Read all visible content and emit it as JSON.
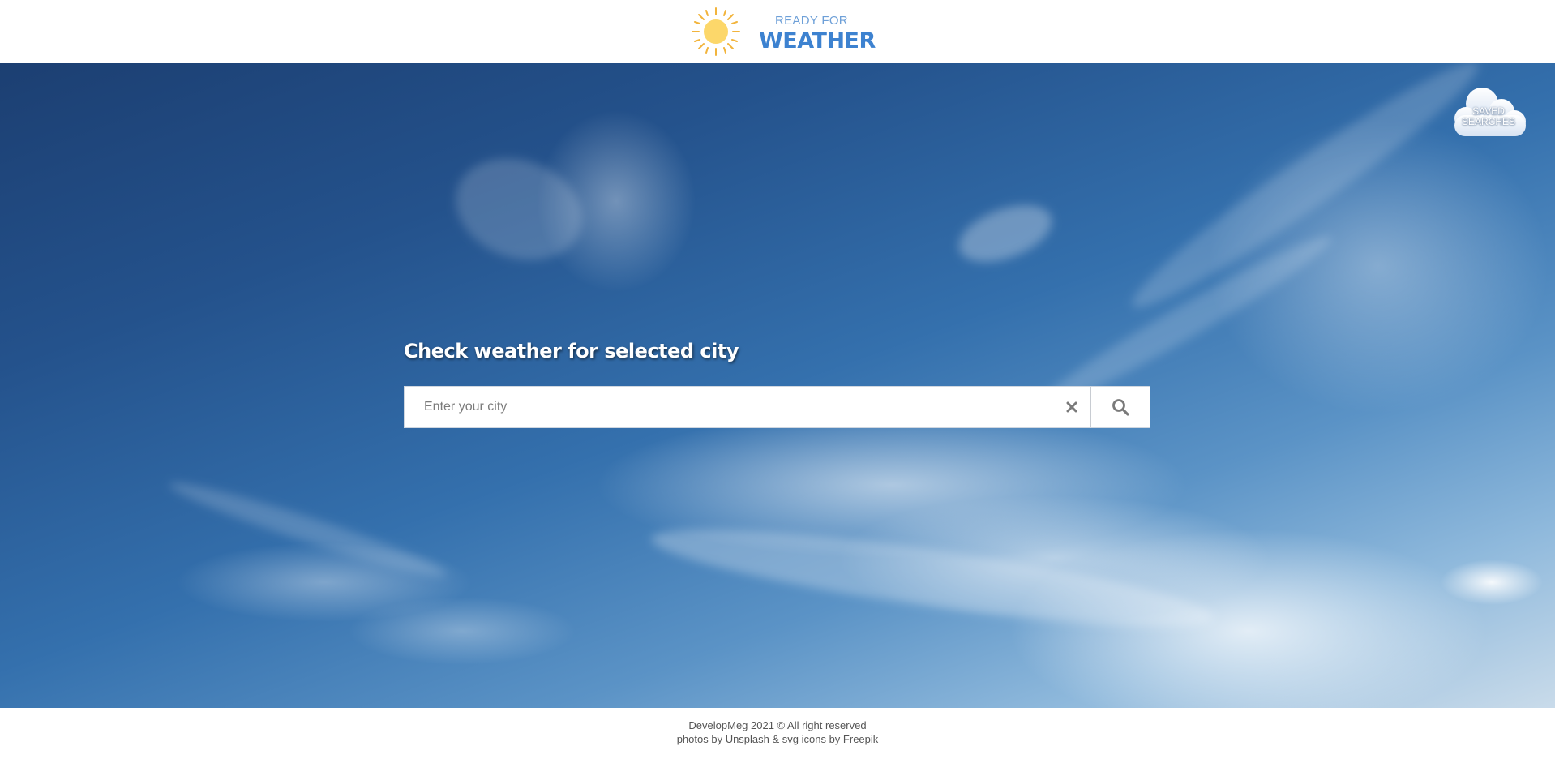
{
  "header": {
    "logo_small": "READY FOR",
    "logo_big": "WEATHER",
    "logo_icon": "sun-icon"
  },
  "saved": {
    "label_line1": "SAVED",
    "label_line2": "SEARCHES",
    "icon": "cloud-icon"
  },
  "search": {
    "title": "Check weather for selected city",
    "placeholder": "Enter your city",
    "value": "",
    "clear_icon": "close-icon",
    "search_icon": "search-icon"
  },
  "footer": {
    "line1": "DevelopMeg 2021 © All right reserved",
    "line2": "photos by Unsplash & svg icons by Freepik"
  },
  "colors": {
    "brand_blue": "#3d82d0",
    "brand_light_blue": "#6ea0d8",
    "sun_yellow": "#fcd76a",
    "sun_ray": "#f2b43c"
  }
}
